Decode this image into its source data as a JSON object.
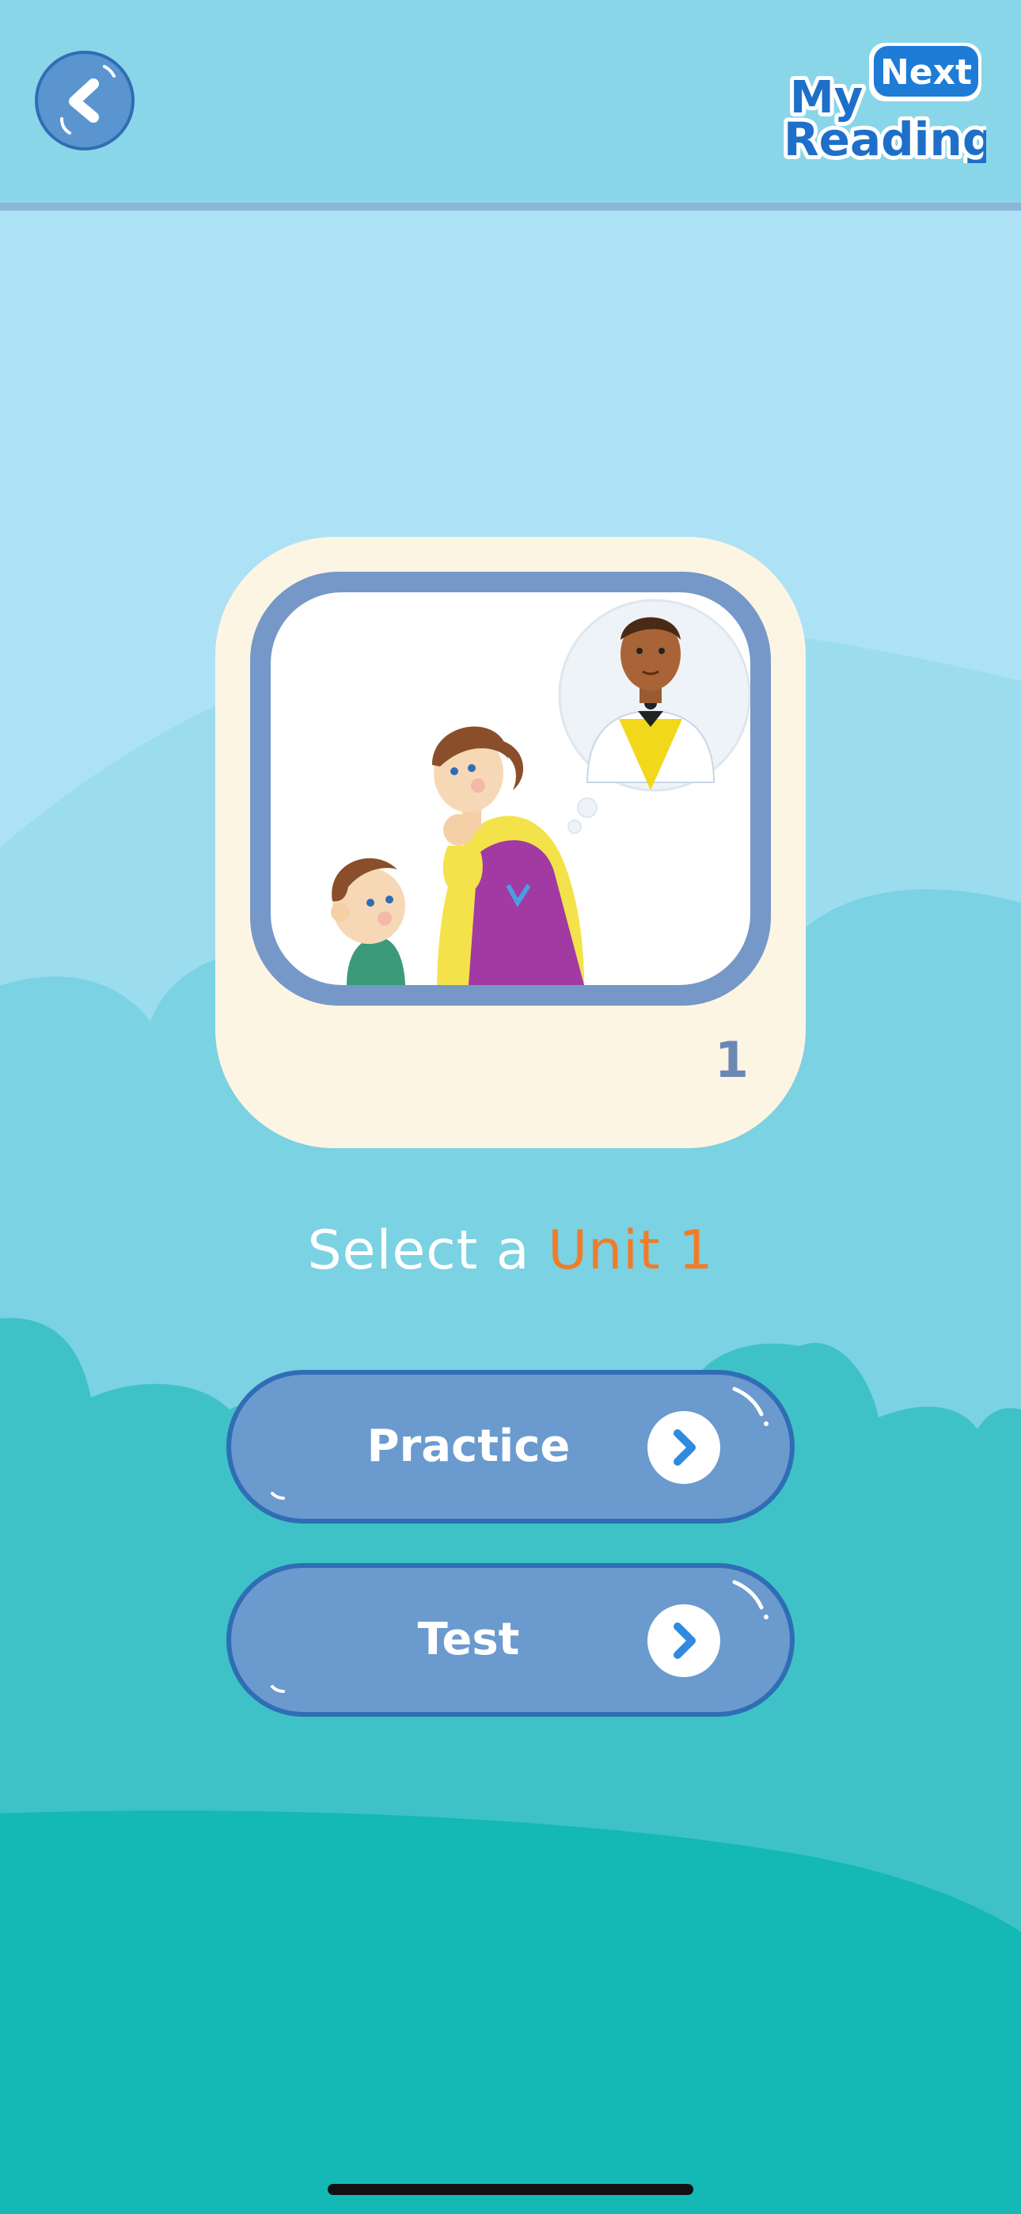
{
  "app": {
    "logo": {
      "word_my": "My",
      "word_next": "Next",
      "word_reading": "Reading"
    }
  },
  "header": {
    "back_icon": "chevron-left-icon"
  },
  "card": {
    "unit_number": "1",
    "illustration": "mother-and-boy-thinking-of-man-illustration"
  },
  "title": {
    "prefix": "Select a ",
    "unit": "Unit 1"
  },
  "actions": [
    {
      "label": "Practice",
      "icon": "chevron-right-icon"
    },
    {
      "label": "Test",
      "icon": "chevron-right-icon"
    }
  ],
  "colors": {
    "header_bg": "#8ad6e9",
    "button_bg": "#6a9ace",
    "button_border": "#2f6db5",
    "accent": "#f07c2b",
    "card_bg": "#fdf5e3"
  }
}
